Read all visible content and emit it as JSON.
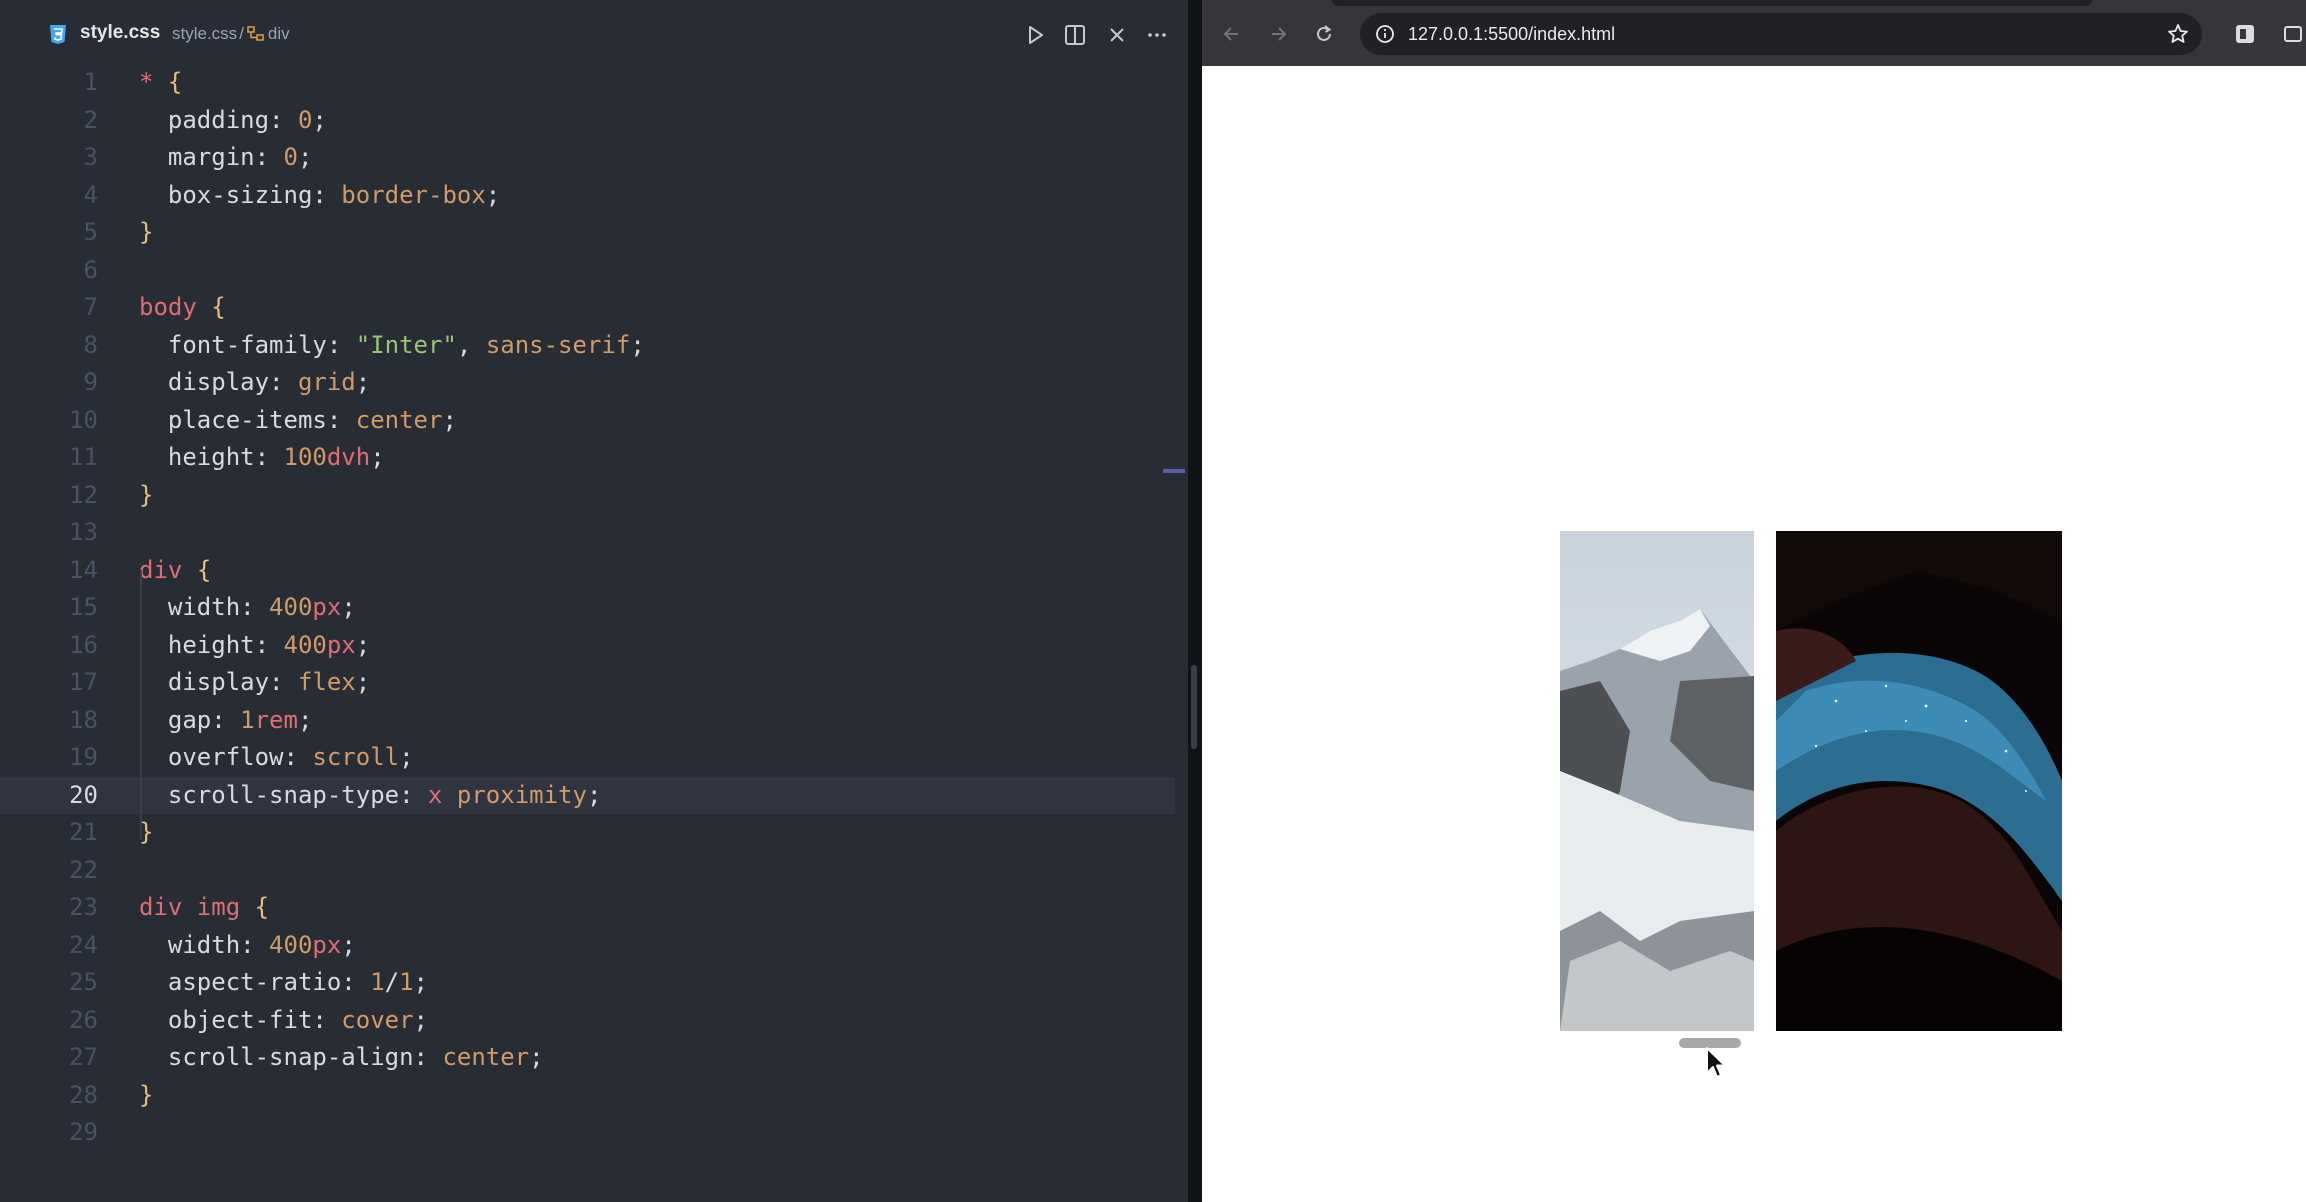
{
  "editor": {
    "tab_title": "style.css",
    "breadcrumb_file": "style.css",
    "breadcrumb_sep": "/",
    "breadcrumb_symbol": "div",
    "active_line": 20,
    "lines": [
      {
        "n": "1",
        "tokens": [
          [
            "sel",
            "*"
          ],
          [
            "punc",
            " "
          ],
          [
            "brace",
            "{"
          ]
        ]
      },
      {
        "n": "2",
        "tokens": [
          [
            "prop",
            "  padding: "
          ],
          [
            "num",
            "0"
          ],
          [
            "punc",
            ";"
          ]
        ]
      },
      {
        "n": "3",
        "tokens": [
          [
            "prop",
            "  margin: "
          ],
          [
            "num",
            "0"
          ],
          [
            "punc",
            ";"
          ]
        ]
      },
      {
        "n": "4",
        "tokens": [
          [
            "prop",
            "  box-sizing: "
          ],
          [
            "val",
            "border-box"
          ],
          [
            "punc",
            ";"
          ]
        ]
      },
      {
        "n": "5",
        "tokens": [
          [
            "brace",
            "}"
          ]
        ]
      },
      {
        "n": "6",
        "tokens": []
      },
      {
        "n": "7",
        "tokens": [
          [
            "sel",
            "body"
          ],
          [
            "punc",
            " "
          ],
          [
            "brace",
            "{"
          ]
        ]
      },
      {
        "n": "8",
        "tokens": [
          [
            "prop",
            "  font-family: "
          ],
          [
            "str",
            "\"Inter\""
          ],
          [
            "punc",
            ", "
          ],
          [
            "val",
            "sans-serif"
          ],
          [
            "punc",
            ";"
          ]
        ]
      },
      {
        "n": "9",
        "tokens": [
          [
            "prop",
            "  display: "
          ],
          [
            "val",
            "grid"
          ],
          [
            "punc",
            ";"
          ]
        ]
      },
      {
        "n": "10",
        "tokens": [
          [
            "prop",
            "  place-items: "
          ],
          [
            "val",
            "center"
          ],
          [
            "punc",
            ";"
          ]
        ]
      },
      {
        "n": "11",
        "tokens": [
          [
            "prop",
            "  height: "
          ],
          [
            "num",
            "100"
          ],
          [
            "unit",
            "dvh"
          ],
          [
            "punc",
            ";"
          ]
        ]
      },
      {
        "n": "12",
        "tokens": [
          [
            "brace",
            "}"
          ]
        ]
      },
      {
        "n": "13",
        "tokens": []
      },
      {
        "n": "14",
        "tokens": [
          [
            "sel",
            "div"
          ],
          [
            "punc",
            " "
          ],
          [
            "brace",
            "{"
          ]
        ]
      },
      {
        "n": "15",
        "tokens": [
          [
            "prop",
            "  width: "
          ],
          [
            "num",
            "400"
          ],
          [
            "unit",
            "px"
          ],
          [
            "punc",
            ";"
          ]
        ]
      },
      {
        "n": "16",
        "tokens": [
          [
            "prop",
            "  height: "
          ],
          [
            "num",
            "400"
          ],
          [
            "unit",
            "px"
          ],
          [
            "punc",
            ";"
          ]
        ]
      },
      {
        "n": "17",
        "tokens": [
          [
            "prop",
            "  display: "
          ],
          [
            "val",
            "flex"
          ],
          [
            "punc",
            ";"
          ]
        ]
      },
      {
        "n": "18",
        "tokens": [
          [
            "prop",
            "  gap: "
          ],
          [
            "num",
            "1"
          ],
          [
            "unit",
            "rem"
          ],
          [
            "punc",
            ";"
          ]
        ]
      },
      {
        "n": "19",
        "tokens": [
          [
            "prop",
            "  overflow: "
          ],
          [
            "val",
            "scroll"
          ],
          [
            "punc",
            ";"
          ]
        ]
      },
      {
        "n": "20",
        "tokens": [
          [
            "prop",
            "  scroll-snap-type: "
          ],
          [
            "sel",
            "x"
          ],
          [
            "punc",
            " "
          ],
          [
            "val",
            "proximity"
          ],
          [
            "punc",
            ";"
          ]
        ]
      },
      {
        "n": "21",
        "tokens": [
          [
            "brace",
            "}"
          ]
        ]
      },
      {
        "n": "22",
        "tokens": []
      },
      {
        "n": "23",
        "tokens": [
          [
            "sel",
            "div img"
          ],
          [
            "punc",
            " "
          ],
          [
            "brace",
            "{"
          ]
        ]
      },
      {
        "n": "24",
        "tokens": [
          [
            "prop",
            "  width: "
          ],
          [
            "num",
            "400"
          ],
          [
            "unit",
            "px"
          ],
          [
            "punc",
            ";"
          ]
        ]
      },
      {
        "n": "25",
        "tokens": [
          [
            "prop",
            "  aspect-ratio: "
          ],
          [
            "num",
            "1"
          ],
          [
            "punc",
            "/"
          ],
          [
            "num",
            "1"
          ],
          [
            "punc",
            ";"
          ]
        ]
      },
      {
        "n": "26",
        "tokens": [
          [
            "prop",
            "  object-fit: "
          ],
          [
            "val",
            "cover"
          ],
          [
            "punc",
            ";"
          ]
        ]
      },
      {
        "n": "27",
        "tokens": [
          [
            "prop",
            "  scroll-snap-align: "
          ],
          [
            "val",
            "center"
          ],
          [
            "punc",
            ";"
          ]
        ]
      },
      {
        "n": "28",
        "tokens": [
          [
            "brace",
            "}"
          ]
        ]
      },
      {
        "n": "29",
        "tokens": []
      }
    ]
  },
  "browser": {
    "url": "127.0.0.1:5500/index.html"
  },
  "colors": {
    "editor_bg": "#282c34",
    "browser_chrome": "#35363a",
    "page_bg": "#ffffff"
  },
  "icons": [
    "css-file-icon",
    "symbol-icon",
    "run-icon",
    "split-editor-icon",
    "close-icon",
    "more-actions-icon",
    "back-icon",
    "forward-icon",
    "reload-icon",
    "site-info-icon",
    "bookmark-star-icon",
    "extension-icon",
    "mouse-cursor-icon"
  ]
}
